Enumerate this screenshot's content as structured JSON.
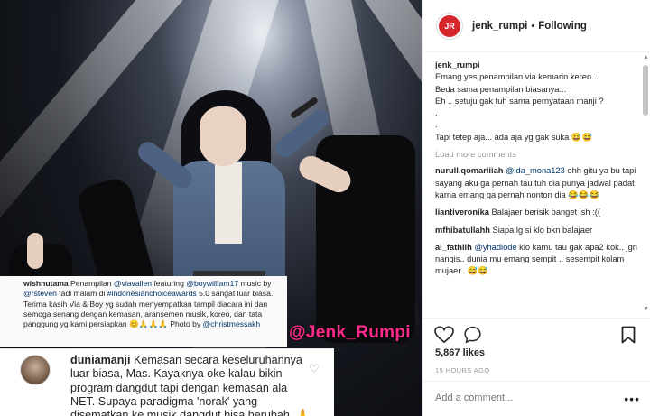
{
  "post": {
    "account": "jenk_rumpi",
    "separator": "•",
    "follow_state": "Following",
    "avatar_text": "JR"
  },
  "photo": {
    "watermark": "@Jenk_Rumpi",
    "caption_card": {
      "user": "wishnutama",
      "t1": " Penampilan ",
      "m1": "@viavallen",
      "t2": " featuring ",
      "m2": "@boywilliam17",
      "t3": " music by ",
      "m3": "@rsteven",
      "t4": " tadi malam di ",
      "m4": "#indonesianchoiceawards",
      "t5": " 5.0 sangat luar biasa. Terima kasih Via & Boy yg sudah menyempatkan tampil diacara ini dan semoga senang dengan kemasan, aransemen musik, koreo, dan tata panggung yg kami persiapkan 😊🙏🙏🙏 Photo by ",
      "m5": "@christmessakh"
    },
    "reply_card": {
      "user": "duniamanji",
      "text": " Kemasan secara keseluruhannya luar biasa, Mas. Kayaknya oke kalau bikin program dangdut tapi dengan kemasan ala NET. Supaya paradigma 'norak' yang disematkan ke musik dangdut bisa berubah. 🙏"
    }
  },
  "caption": {
    "user": "jenk_rumpi",
    "lines": [
      "Emang yes penampilan via kemarin keren...",
      "Beda sama penampilan biasanya...",
      "Eh .. setuju gak tuh sama pernyataan manji ?",
      ".",
      ".",
      "Tapi tetep aja... ada aja yg gak suka 😅😅"
    ]
  },
  "load_more": "Load more comments",
  "comments": [
    {
      "user": "nurull.qomariiiah",
      "mention": "@ida_mona123",
      "text": " ohh gitu ya bu tapi sayang aku ga pernah tau tuh dia punya jadwal padat karna emang ga pernah nonton dia 😂😂😂"
    },
    {
      "user": "liantiveronika",
      "mention": "",
      "text": " Balajaer berisik banget ish :(("
    },
    {
      "user": "mfhibatullahh",
      "mention": "",
      "text": " Siapa lg si klo bkn balajaer"
    },
    {
      "user": "al_fathiih",
      "mention": "@yhadiode",
      "text": " klo kamu tau gak apa2 kok.. jgn nangis.. dunia mu emang sempit .. sesempit kolam mujaer.. 😅😅"
    }
  ],
  "likes": "5,867 likes",
  "timestamp": "15 HOURS AGO",
  "add_comment_placeholder": "Add a comment...",
  "more_options": "•••"
}
